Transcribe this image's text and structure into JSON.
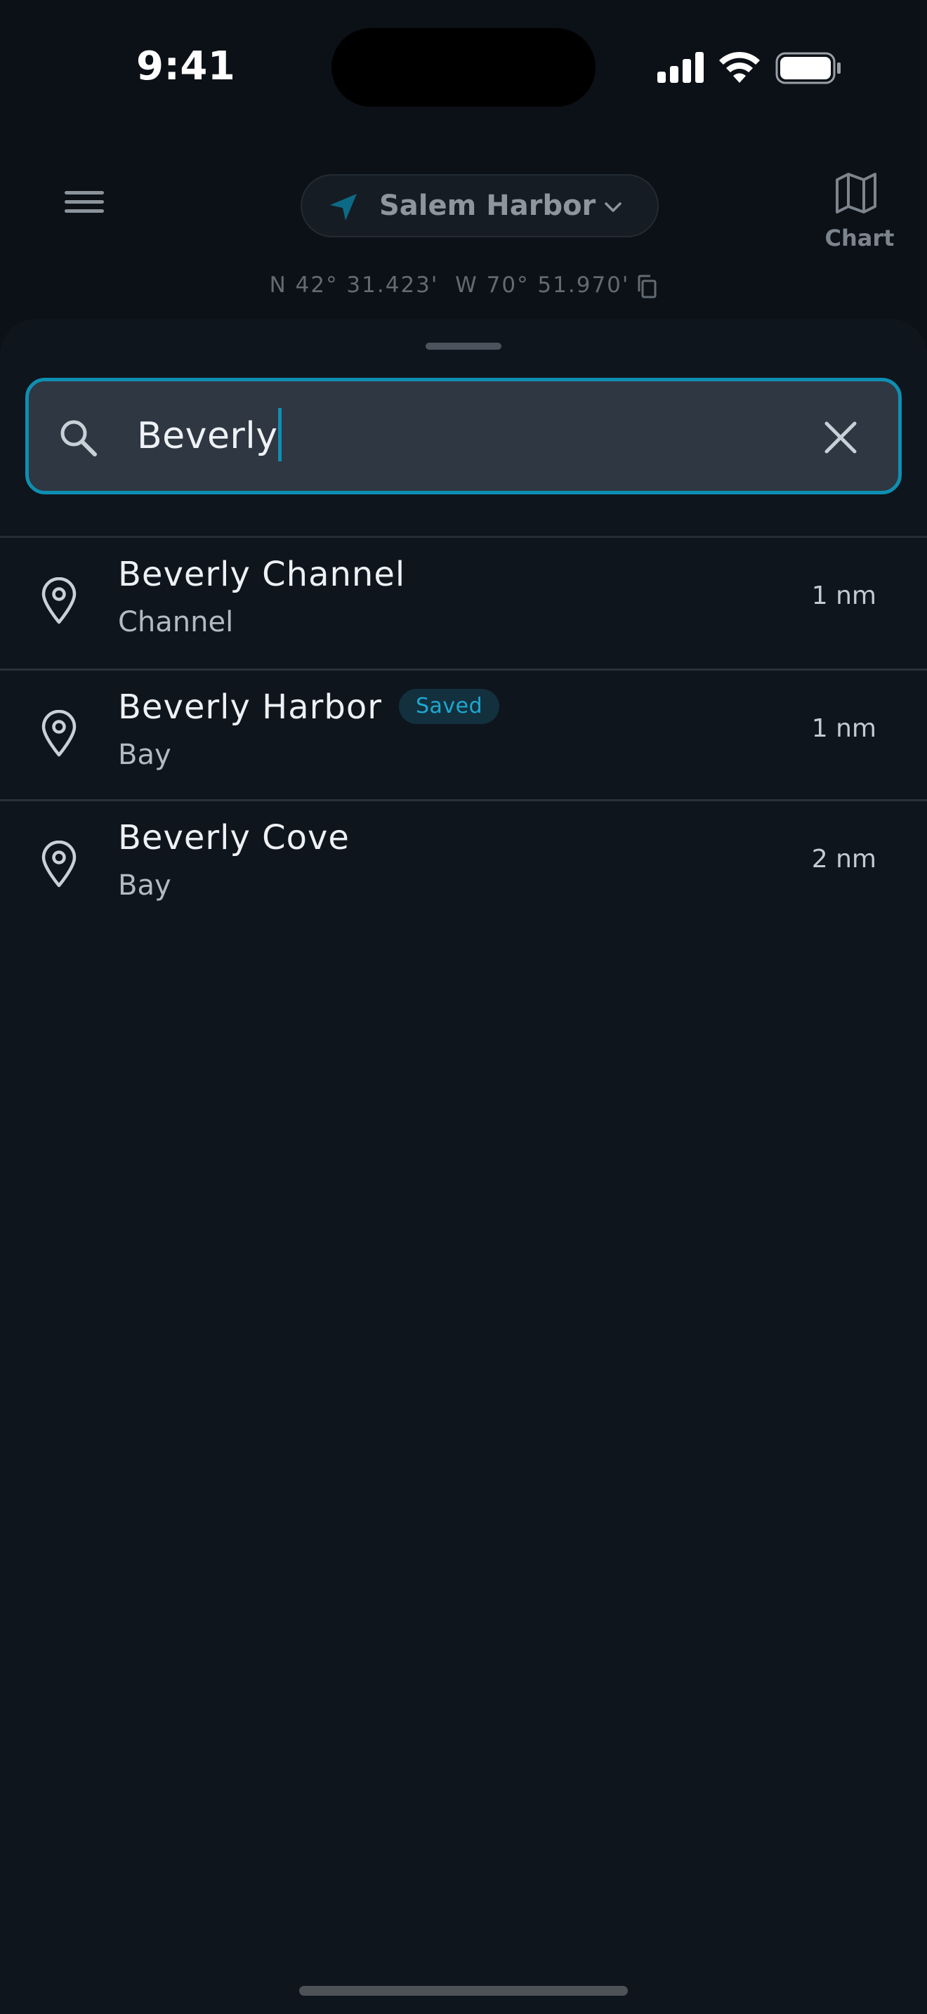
{
  "status_bar": {
    "time": "9:41"
  },
  "header": {
    "location_name": "Salem Harbor",
    "chart_label": "Chart",
    "coordinates": "N 42° 31.423'  W 70° 51.970'"
  },
  "search": {
    "value": "Beverly"
  },
  "results": [
    {
      "title": "Beverly Channel",
      "subtitle": "Channel",
      "distance": "1 nm",
      "badge": ""
    },
    {
      "title": "Beverly Harbor",
      "subtitle": "Bay",
      "distance": "1 nm",
      "badge": "Saved"
    },
    {
      "title": "Beverly Cove",
      "subtitle": "Bay",
      "distance": "2 nm",
      "badge": ""
    }
  ],
  "colors": {
    "accent": "#0e8fb2",
    "badge_text": "#1ea7d0",
    "background": "#0f151d"
  }
}
